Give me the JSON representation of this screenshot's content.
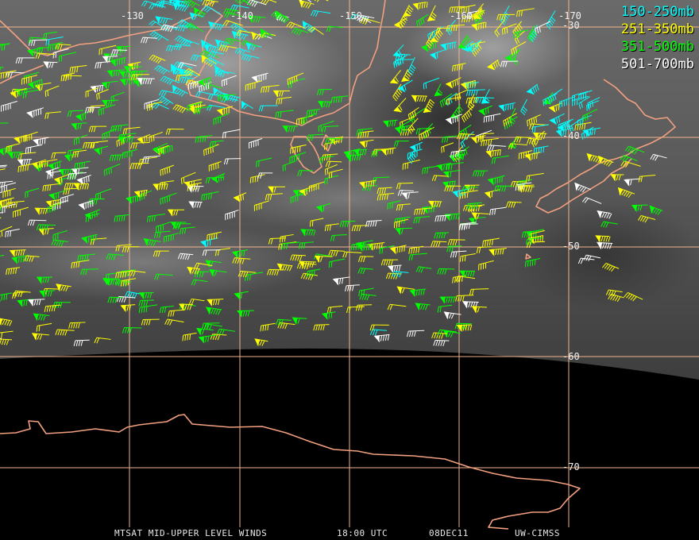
{
  "legend": [
    {
      "label": "150-250mb",
      "color": "#00ffff"
    },
    {
      "label": "251-350mb",
      "color": "#ffff00"
    },
    {
      "label": "351-500mb",
      "color": "#00ff00"
    },
    {
      "label": "501-700mb",
      "color": "#ffffff"
    }
  ],
  "longitude_labels": [
    "-130",
    "-140",
    "-150",
    "-160",
    "-170"
  ],
  "latitude_labels": [
    "-30",
    "-40",
    "-50",
    "-60",
    "-70"
  ],
  "footer": {
    "product": "MTSAT MID-UPPER LEVEL WINDS",
    "time": "18:00 UTC",
    "date": "08DEC11",
    "source": "UW-CIMSS"
  },
  "colors": {
    "grid": "#f2b48c",
    "coastline": "#f2a080",
    "background": "#000000"
  }
}
